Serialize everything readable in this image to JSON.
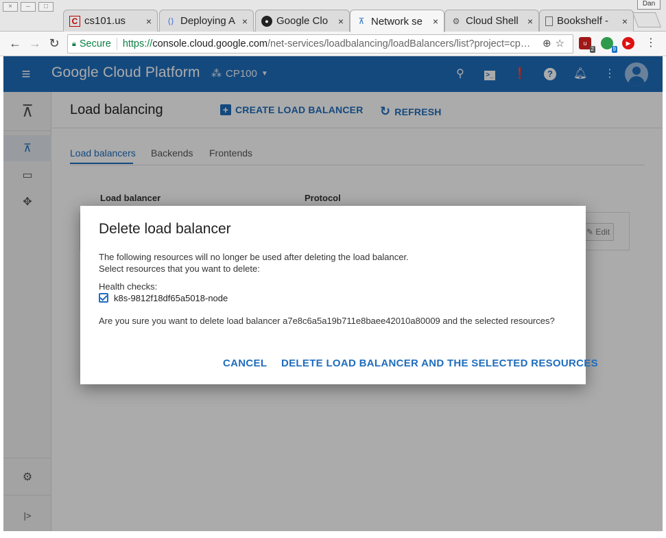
{
  "browser": {
    "tabs": [
      {
        "title": "cs101.us",
        "icon": "c-favicon"
      },
      {
        "title": "Deploying A",
        "icon": "code-favicon"
      },
      {
        "title": "Google Clo",
        "icon": "github-icon"
      },
      {
        "title": "Network se",
        "icon": "network-favicon",
        "active": true
      },
      {
        "title": "Cloud Shell",
        "icon": "cloud-shell-favicon"
      },
      {
        "title": "Bookshelf -",
        "icon": "page-icon"
      }
    ],
    "close_glyph": "×",
    "profile_badge": "Dan",
    "omnibox": {
      "secure_label": "Secure",
      "protocol": "https://",
      "host": "console.cloud.google.com",
      "path": "/net-services/loadbalancing/loadBalancers/list?project=cp…"
    },
    "extensions": [
      {
        "name": "ublock-icon",
        "badge": "2",
        "color": "#a01818"
      },
      {
        "name": "green-dot-icon",
        "badge": "9",
        "color": "#2e9a4b"
      },
      {
        "name": "play-icon",
        "badge": "",
        "color": "#d11"
      }
    ]
  },
  "header": {
    "brand": "Google Cloud Platform",
    "project": "CP100",
    "color": "#1f6dbd"
  },
  "page": {
    "title": "Load balancing",
    "create_label": "CREATE LOAD BALANCER",
    "refresh_label": "REFRESH",
    "subtabs": [
      "Load balancers",
      "Backends",
      "Frontends"
    ],
    "columns": [
      "Load balancer",
      "Protocol"
    ],
    "edit_label": "Edit"
  },
  "dialog": {
    "title": "Delete load balancer",
    "line1": "The following resources will no longer be used after deleting the load balancer.",
    "line2": "Select resources that you want to delete:",
    "health_checks_label": "Health checks:",
    "health_check_item": "k8s-9812f18df65a5018-node",
    "confirm_text": "Are you sure you want to delete load balancer a7e8c6a5a19b711e8baee42010a80009 and the selected resources?",
    "cancel_label": "CANCEL",
    "delete_label": "DELETE LOAD BALANCER AND THE SELECTED RESOURCES"
  }
}
